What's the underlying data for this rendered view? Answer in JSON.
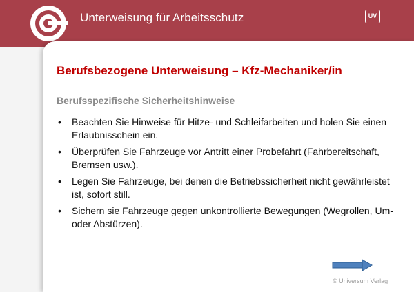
{
  "header": {
    "title": "Unterweisung für Arbeitsschutz",
    "badge": "UV",
    "logo_icon": "target-logo-icon"
  },
  "slide": {
    "title": "Berufsbezogene Unterweisung – Kfz-Mechaniker/in",
    "section_heading": "Berufsspezifische Sicherheitshinweise",
    "bullet_symbol": "•",
    "bullets": [
      "Beachten Sie Hinweise für Hitze- und Schleifarbeiten und holen Sie einen Erlaubnisschein ein.",
      "Überprüfen Sie Fahrzeuge vor Antritt einer Probefahrt (Fahrbereitschaft, Bremsen usw.).",
      "Legen Sie Fahrzeuge, bei denen die Betriebssicherheit nicht gewährleistet ist, sofort still.",
      "Sichern sie Fahrzeuge gegen unkontrollierte Bewegungen (Wegrollen, Um- oder Abstürzen)."
    ]
  },
  "footer": {
    "copyright": "© Universum Verlag",
    "next_icon": "arrow-right-icon"
  },
  "colors": {
    "header_band": "#a8404a",
    "title_red": "#c00000",
    "heading_gray": "#8a8a8a",
    "arrow_blue": "#4f81bd"
  }
}
